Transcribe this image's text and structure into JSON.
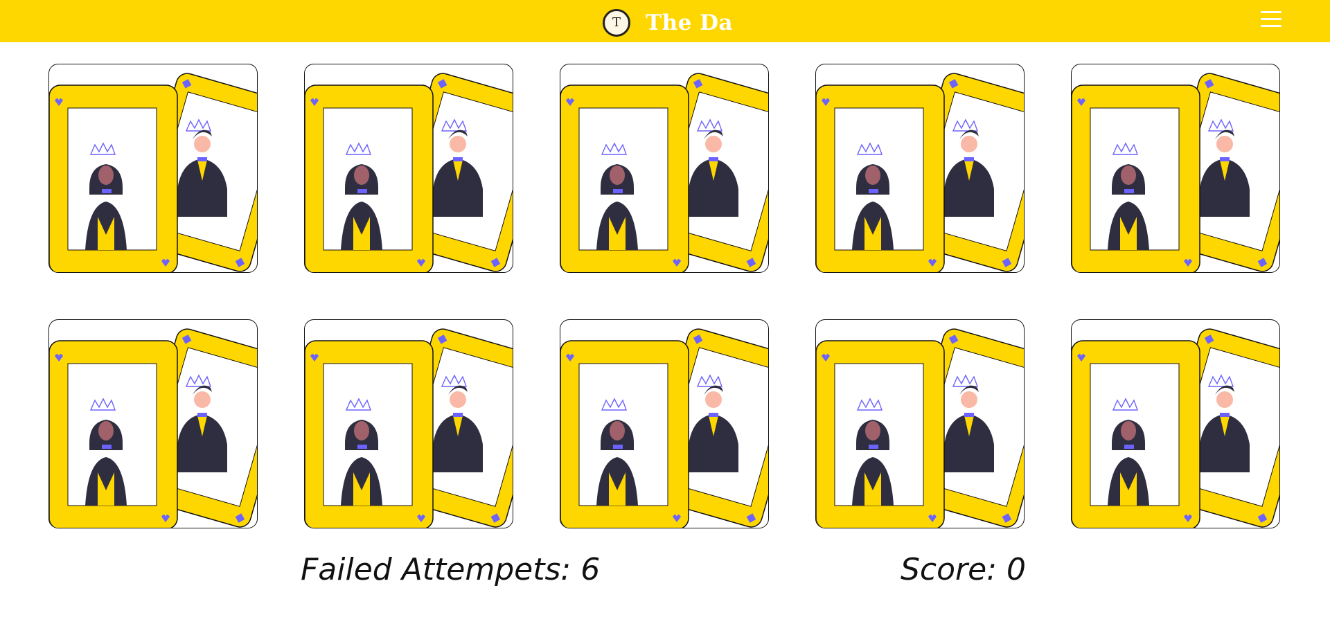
{
  "header": {
    "logo_letter": "T",
    "title": "The Da",
    "menu_icon": "hamburger-icon",
    "background_color": "#FFD700"
  },
  "board": {
    "card_count": 10,
    "card_face_illustration": "king-and-queen-cards",
    "card_colors": {
      "frame": "#FFD700",
      "suit": "#6C63FF",
      "outline": "#111111"
    }
  },
  "stats": {
    "failed_label": "Failed Attempets:",
    "failed_value": "6",
    "score_label": "Score:",
    "score_value": "0"
  }
}
